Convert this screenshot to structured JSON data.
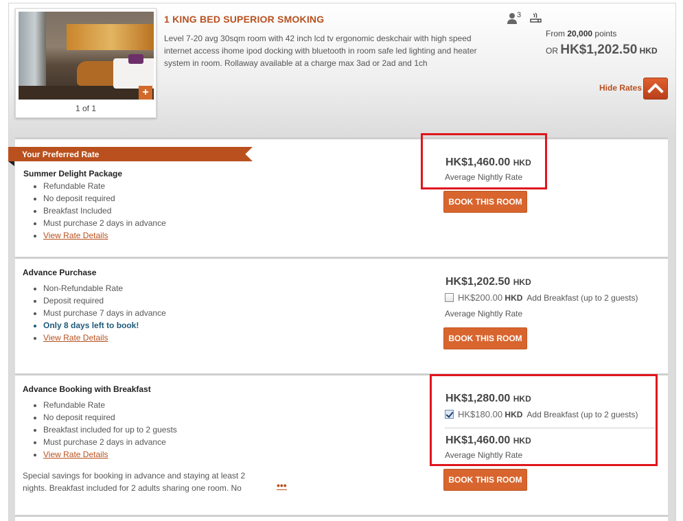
{
  "room": {
    "title": "1 KING BED SUPERIOR SMOKING",
    "description": "Level 7-20 avg 30sqm room with 42 inch lcd tv ergonomic deskchair with high speed internet access ihome ipod docking with bluetooth in room safe led lighting and heater system in room. Rollaway available at a charge max 3ad or 2ad and 1ch",
    "photo_counter": "1 of 1",
    "max_occupancy": "3",
    "from_label": "From",
    "points": "20,000",
    "points_label": "points",
    "or_label": "OR",
    "or_price": "HK$1,202",
    "or_price_dec": ".50",
    "or_currency": "HKD",
    "hide_rates_label": "Hide Rates",
    "icons": {
      "occupancy": "person-icon",
      "smoking": "smoking-icon",
      "plus": "plus-icon",
      "hide": "chevron-up-icon"
    }
  },
  "preferred_rate_label": "Your Preferred Rate",
  "rates": [
    {
      "name": "Summer Delight Package",
      "features": [
        "Refundable Rate",
        "No deposit required",
        "Breakfast Included",
        "Must purchase 2 days in advance"
      ],
      "details_link": "View Rate Details",
      "price": "HK$1,460.00",
      "currency": "HKD",
      "avg_label": "Average Nightly Rate",
      "button": "BOOK THIS ROOM"
    },
    {
      "name": "Advance Purchase",
      "features": [
        "Non-Refundable Rate",
        "Deposit required",
        "Must purchase 7 days in advance"
      ],
      "alert": "Only 8 days left to book!",
      "details_link": "View Rate Details",
      "price": "HK$1,202.50",
      "currency": "HKD",
      "breakfast_price": "HK$200.00",
      "breakfast_currency": "HKD",
      "breakfast_label": "Add Breakfast (up to 2 guests)",
      "breakfast_checked": false,
      "avg_label": "Average Nightly Rate",
      "button": "BOOK THIS ROOM"
    },
    {
      "name": "Advance Booking with Breakfast",
      "features": [
        "Refundable Rate",
        "No deposit required",
        "Breakfast included for up to 2 guests",
        "Must purchase 2 days in advance"
      ],
      "details_link": "View Rate Details",
      "price": "HK$1,280.00",
      "currency": "HKD",
      "breakfast_price": "HK$180.00",
      "breakfast_currency": "HKD",
      "breakfast_label": "Add Breakfast (up to 2 guests)",
      "breakfast_checked": true,
      "total_price": "HK$1,460.00",
      "total_currency": "HKD",
      "avg_label": "Average Nightly Rate",
      "special": "Special savings for booking in advance and staying at least 2 nights. Breakfast included for 2 adults sharing one room. No",
      "more": "•••",
      "button": "BOOK THIS ROOM"
    }
  ]
}
